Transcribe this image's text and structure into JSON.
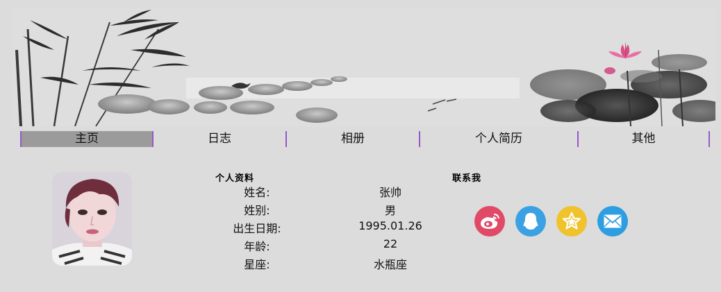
{
  "nav": {
    "items": [
      "主页",
      "日志",
      "相册",
      "个人简历",
      "其他"
    ],
    "active": "主页",
    "colors": {
      "active_bg": "#9b9b9b",
      "divider": "#9a56c7"
    }
  },
  "profile": {
    "title": "个人资料",
    "rows": [
      {
        "label": "姓名:",
        "value": "张帅"
      },
      {
        "label": "姓别:",
        "value": "男"
      },
      {
        "label": "出生日期:",
        "value": "1995.01.26"
      },
      {
        "label": "年龄:",
        "value": "22"
      },
      {
        "label": "星座:",
        "value": "水瓶座"
      }
    ]
  },
  "contact": {
    "title": "联系我",
    "icons": [
      {
        "name": "weibo-icon",
        "color": "#e04a67"
      },
      {
        "name": "qq-icon",
        "color": "#3ba1e3"
      },
      {
        "name": "favorite-star-icon",
        "color": "#f0c22c"
      },
      {
        "name": "email-icon",
        "color": "#2e9ee2"
      }
    ]
  }
}
